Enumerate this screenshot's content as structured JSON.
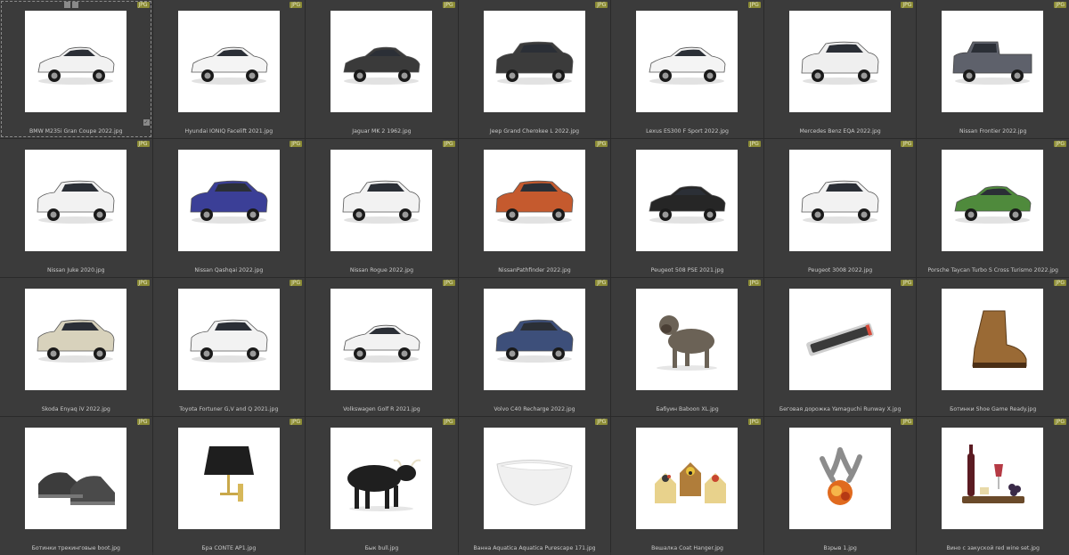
{
  "badge_label": "JPG",
  "selection_tools": [
    "square-select-icon",
    "brush-icon"
  ],
  "items": [
    {
      "caption": "BMW M235i Gran Coupe 2022.jpg",
      "kind": "car",
      "color": "#f2f2f2"
    },
    {
      "caption": "Hyundai IONIQ Facelift 2021.jpg",
      "kind": "car",
      "color": "#f4f4f4"
    },
    {
      "caption": "Jaguar MK 2 1962.jpg",
      "kind": "car",
      "color": "#3a3a3a"
    },
    {
      "caption": "Jeep Grand Cherokee L 2022.jpg",
      "kind": "suv",
      "color": "#3b3b3b"
    },
    {
      "caption": "Lexus ES300 F Sport 2022.jpg",
      "kind": "car",
      "color": "#f4f4f4"
    },
    {
      "caption": "Mercedes Benz EQA 2022.jpg",
      "kind": "suv",
      "color": "#efefef"
    },
    {
      "caption": "Nissan Frontier 2022.jpg",
      "kind": "truck",
      "color": "#5e616b"
    },
    {
      "caption": "Nissan Juke 2020.jpg",
      "kind": "suv",
      "color": "#f2f2f2"
    },
    {
      "caption": "Nissan Qashqai 2022.jpg",
      "kind": "suv",
      "color": "#3b3f97"
    },
    {
      "caption": "Nissan Rogue 2022.jpg",
      "kind": "suv",
      "color": "#f2f2f2"
    },
    {
      "caption": "NissanPathfinder 2022.jpg",
      "kind": "suv",
      "color": "#c55a2e"
    },
    {
      "caption": "Peugeot 508 PSE 2021.jpg",
      "kind": "car",
      "color": "#262626"
    },
    {
      "caption": "Peugeot 3008 2022.jpg",
      "kind": "suv",
      "color": "#f2f2f2"
    },
    {
      "caption": "Porsche Taycan Turbo S Cross Turismo 2022.jpg",
      "kind": "car",
      "color": "#4f8a3c"
    },
    {
      "caption": "Skoda Enyaq iV 2022.jpg",
      "kind": "suv",
      "color": "#d8d2bc"
    },
    {
      "caption": "Toyota Fortuner G,V and Q 2021.jpg",
      "kind": "suv",
      "color": "#f2f2f2"
    },
    {
      "caption": "Volkswagen Golf R 2021.jpg",
      "kind": "car",
      "color": "#f2f2f2"
    },
    {
      "caption": "Volvo C40 Recharge 2022.jpg",
      "kind": "suv",
      "color": "#3d4f7a"
    },
    {
      "caption": "Бабуин Baboon XL.jpg",
      "kind": "baboon",
      "color": "#6b6256"
    },
    {
      "caption": "Беговая дорожка Yamaguchi Runway X.jpg",
      "kind": "treadmill",
      "color": "#555555"
    },
    {
      "caption": "Ботинки Shoe Game Ready.jpg",
      "kind": "boot",
      "color": "#9a6a35"
    },
    {
      "caption": "Ботинки трекинговые boot.jpg",
      "kind": "shoes",
      "color": "#3c3c3c"
    },
    {
      "caption": "Бра CONTE AP1.jpg",
      "kind": "lamp",
      "color": "#1e1e1e"
    },
    {
      "caption": "Бык bull.jpg",
      "kind": "bull",
      "color": "#1f1f1f"
    },
    {
      "caption": "Ванна Aquatica Aquatica Purescape 171.jpg",
      "kind": "bathtub",
      "color": "#f0f0f0"
    },
    {
      "caption": "Вешалка Coat Hanger.jpg",
      "kind": "hanger",
      "color": "#b07d3a"
    },
    {
      "caption": "Взрыв 1.jpg",
      "kind": "explosion",
      "color": "#e06a1e"
    },
    {
      "caption": "Вино с закуской red wine set.jpg",
      "kind": "wine",
      "color": "#5b1b22"
    }
  ]
}
